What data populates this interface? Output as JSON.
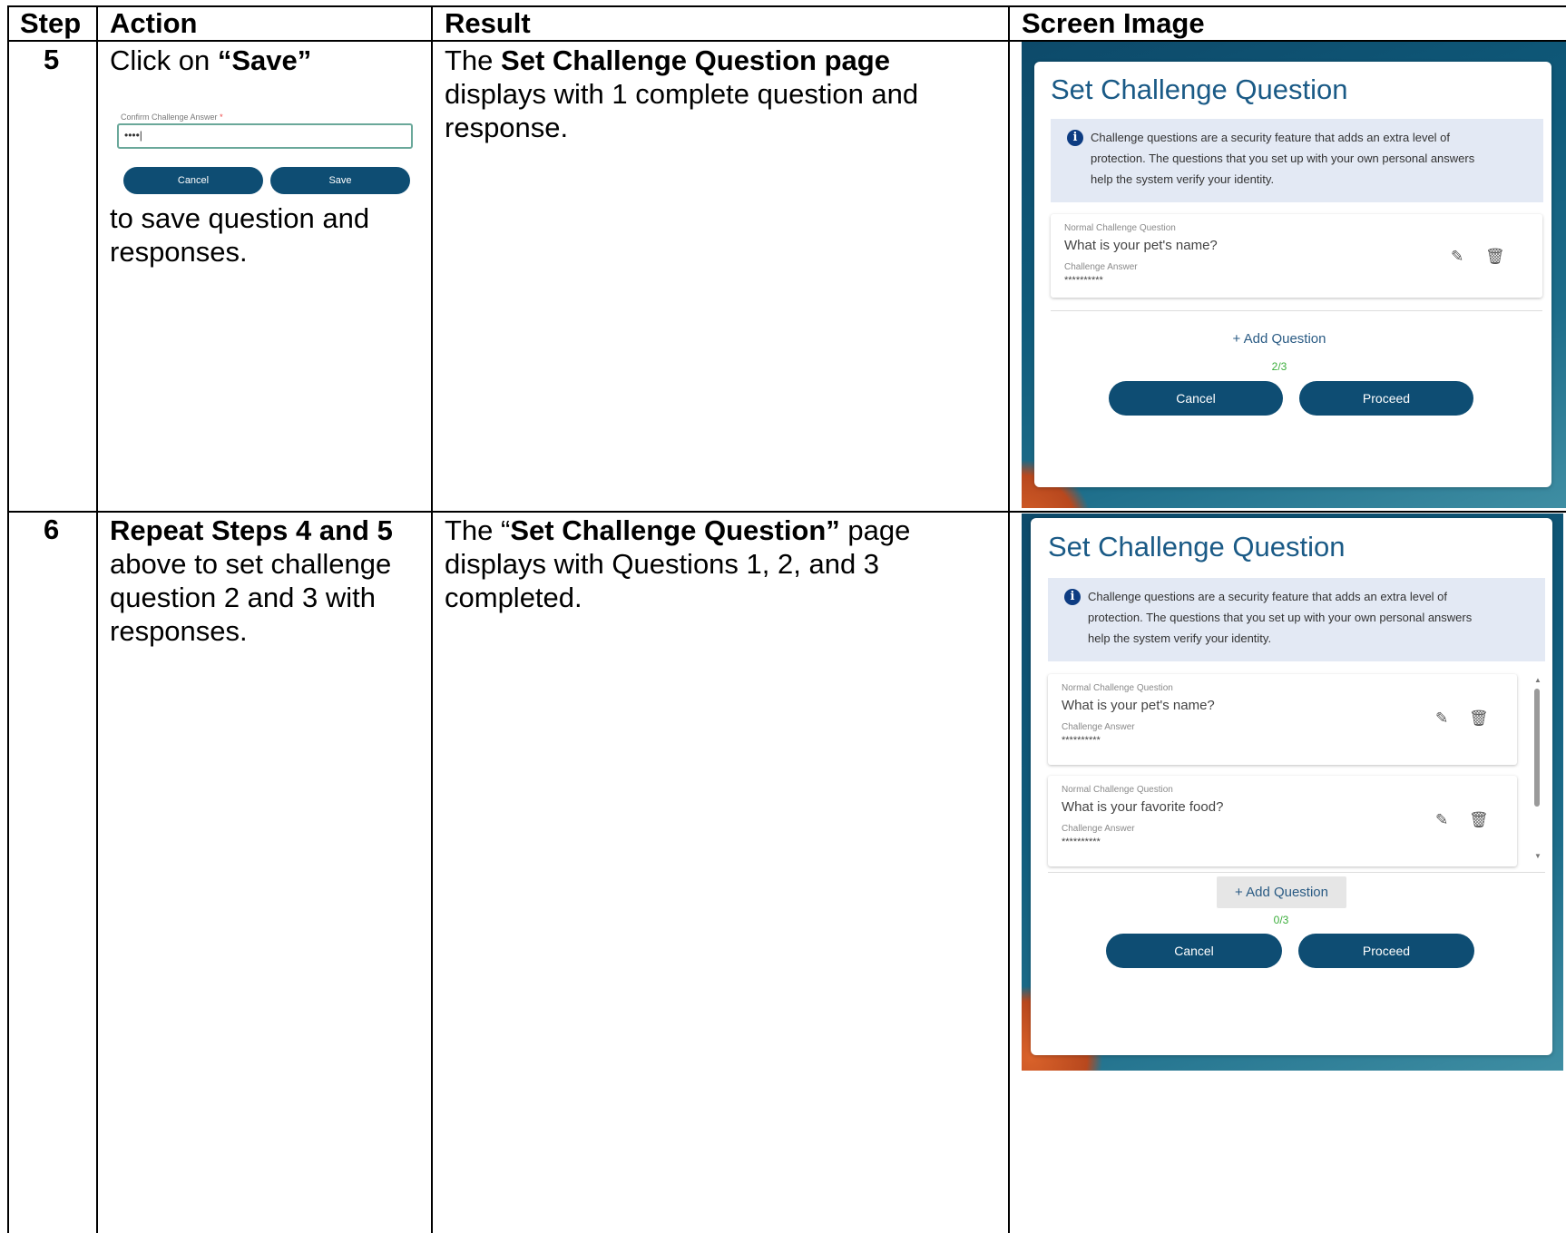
{
  "table": {
    "headers": [
      "Step",
      "Action",
      "Result",
      "Screen Image"
    ],
    "rows": [
      {
        "step": "5",
        "action": {
          "prefix": "Click on ",
          "bold": "“Save”",
          "suffix": "to save question and responses."
        },
        "result": {
          "prefix": "The ",
          "bold": "Set Challenge Question page",
          "suffix": " displays with 1 complete question and response."
        },
        "mini_form": {
          "label": "Confirm Challenge Answer",
          "required_mark": "*",
          "value": "••••|",
          "cancel_label": "Cancel",
          "save_label": "Save"
        },
        "screen": {
          "title": "Set Challenge Question",
          "info_text": "Challenge questions are a security feature that adds an extra level of protection. The questions that you set up with your own personal answers help the system verify your identity.",
          "questions": [
            {
              "type_label": "Normal Challenge Question",
              "question": "What is your pet's name?",
              "answer_label": "Challenge Answer",
              "answer": "**********"
            }
          ],
          "add_question_label": "+ Add Question",
          "progress": "2/3",
          "cancel_label": "Cancel",
          "proceed_label": "Proceed"
        }
      },
      {
        "step": "6",
        "action": {
          "bold": "Repeat Steps 4 and 5",
          "suffix": " above to set challenge question 2 and 3 with responses."
        },
        "result": {
          "prefix": "The “",
          "bold": "Set Challenge Question”",
          "suffix": " page displays with Questions 1, 2, and 3 completed."
        },
        "screen": {
          "title": "Set Challenge Question",
          "info_text": "Challenge questions are a security feature that adds an extra level of protection. The questions that you set up with your own personal answers help the system verify your identity.",
          "questions": [
            {
              "type_label": "Normal Challenge Question",
              "question": "What is your pet's name?",
              "answer_label": "Challenge Answer",
              "answer": "**********"
            },
            {
              "type_label": "Normal Challenge Question",
              "question": "What is your favorite food?",
              "answer_label": "Challenge Answer",
              "answer": "**********"
            }
          ],
          "add_question_label": "+ Add Question",
          "progress": "0/3",
          "cancel_label": "Cancel",
          "proceed_label": "Proceed"
        }
      }
    ]
  },
  "icons": {
    "info": "info-circle-icon",
    "edit": "pencil-icon",
    "delete": "trash-icon"
  },
  "colors": {
    "title_blue": "#1a5a86",
    "button_navy": "#0e4d73",
    "progress_green": "#3cae3c",
    "info_bg": "#e3e9f4"
  }
}
